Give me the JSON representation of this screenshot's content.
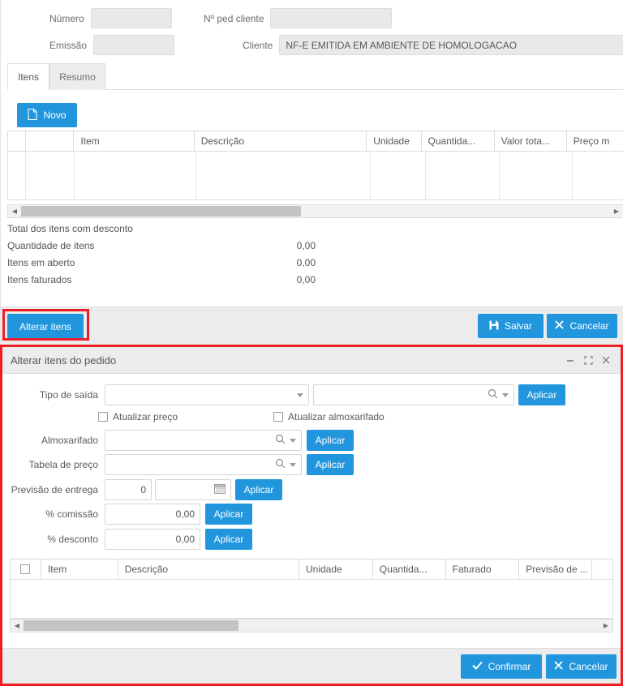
{
  "top_form": {
    "fields": [
      {
        "label": "Número",
        "value": ""
      },
      {
        "label": "Nº ped cliente",
        "value": ""
      },
      {
        "label": "Emissão",
        "value": ""
      },
      {
        "label": "Cliente",
        "value": "NF-E EMITIDA EM AMBIENTE DE HOMOLOGACAO"
      }
    ]
  },
  "tabs": [
    {
      "label": "Itens",
      "active": true
    },
    {
      "label": "Resumo",
      "active": false
    }
  ],
  "toolbar": {
    "new_label": "Novo",
    "new_icon": "document-icon"
  },
  "items_grid": {
    "columns": [
      "",
      "",
      "Item",
      "Descrição",
      "Unidade",
      "Quantida...",
      "Valor tota...",
      "Preço m"
    ]
  },
  "totals": {
    "rows": [
      {
        "label": "Total dos itens com desconto",
        "value": ""
      },
      {
        "label": "Quantidade de itens",
        "value": "0,00"
      },
      {
        "label": "Itens em aberto",
        "value": "0,00"
      },
      {
        "label": "Itens faturados",
        "value": "0,00"
      }
    ]
  },
  "footer": {
    "alterar_itens_label": "Alterar itens",
    "save_label": "Salvar",
    "save_icon": "floppy-disk-icon",
    "cancel_label": "Cancelar",
    "cancel_icon": "close-x-icon"
  },
  "dialog": {
    "title": "Alterar itens do pedido",
    "window_controls": {
      "minimize_icon": "minimize-icon",
      "maximize_icon": "maximize-icon",
      "close_icon": "close-icon"
    },
    "tipo_saida": {
      "label": "Tipo de saída",
      "select_value": "",
      "search_value": "",
      "apply_label": "Aplicar"
    },
    "checkboxes": [
      {
        "label": "Atualizar preço",
        "checked": false
      },
      {
        "label": "Atualizar almoxarifado",
        "checked": false
      }
    ],
    "rows": [
      {
        "label": "Almoxarifado",
        "value": "",
        "apply_label": "Aplicar"
      },
      {
        "label": "Tabela de preço",
        "value": "",
        "apply_label": "Aplicar"
      },
      {
        "label": "Previsão de entrega",
        "value": "0",
        "date_value": "",
        "apply_label": "Aplicar"
      },
      {
        "label": "% comissão",
        "value": "0,00",
        "apply_label": "Aplicar"
      },
      {
        "label": "% desconto",
        "value": "0,00",
        "apply_label": "Aplicar"
      }
    ],
    "grid": {
      "columns": [
        "",
        "Item",
        "Descrição",
        "Unidade",
        "Quantida...",
        "Faturado",
        "Previsão de ...",
        ""
      ]
    },
    "confirm_label": "Confirmar",
    "confirm_icon": "check-icon",
    "cancel_label": "Cancelar",
    "cancel_icon": "close-x-icon"
  },
  "colors": {
    "accent_blue": "#2196dd",
    "annotation_red": "#ee1c25",
    "panel_gray": "#ececec"
  }
}
